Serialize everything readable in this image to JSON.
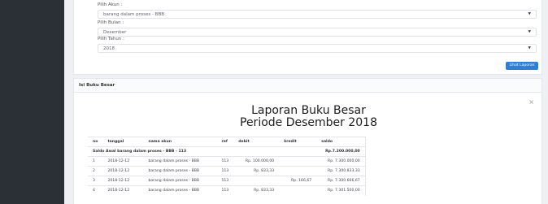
{
  "filter": {
    "akun_label": "Pilih Akun :",
    "akun_value": "barang dalam proses - BBB",
    "bulan_label": "Pilih Bulan :",
    "bulan_value": "Desember",
    "tahun_label": "Pilih Tahun :",
    "tahun_value": "2018",
    "button_label": "Lihat Laporan"
  },
  "result": {
    "header": "Isi Buku Besar",
    "close_symbol": "×",
    "title": "Laporan Buku Besar",
    "subtitle": "Periode Desember 2018",
    "columns": [
      "no",
      "tanggal",
      "nama akun",
      "ref",
      "debit",
      "kredit",
      "saldo"
    ],
    "saldo_awal_label": "Saldo Awal barang dalam proses - BBB - 113",
    "saldo_awal_value": "Rp.7.200.000,00",
    "rows": [
      {
        "no": "1",
        "tanggal": "2018-12-12",
        "nama": "barang dalam proses - BBB",
        "ref": "113",
        "debit": "Rp. 100.000,00",
        "kredit": "",
        "saldo": "Rp. 7.300.000,00"
      },
      {
        "no": "2",
        "tanggal": "2018-12-12",
        "nama": "barang dalam proses - BBB",
        "ref": "113",
        "debit": "Rp. 833,33",
        "kredit": "",
        "saldo": "Rp. 7.300.833,33"
      },
      {
        "no": "3",
        "tanggal": "2018-12-12",
        "nama": "barang dalam proses - BBB",
        "ref": "113",
        "debit": "",
        "kredit": "Rp. 166,67",
        "saldo": "Rp. 7.300.666,67"
      },
      {
        "no": "4",
        "tanggal": "2018-12-12",
        "nama": "barang dalam proses - BBB",
        "ref": "113",
        "debit": "Rp. 833,33",
        "kredit": "",
        "saldo": "Rp. 7.301.500,00"
      }
    ]
  },
  "colors": {
    "sidebar": "#2b2f36",
    "button": "#2f7fd6"
  }
}
